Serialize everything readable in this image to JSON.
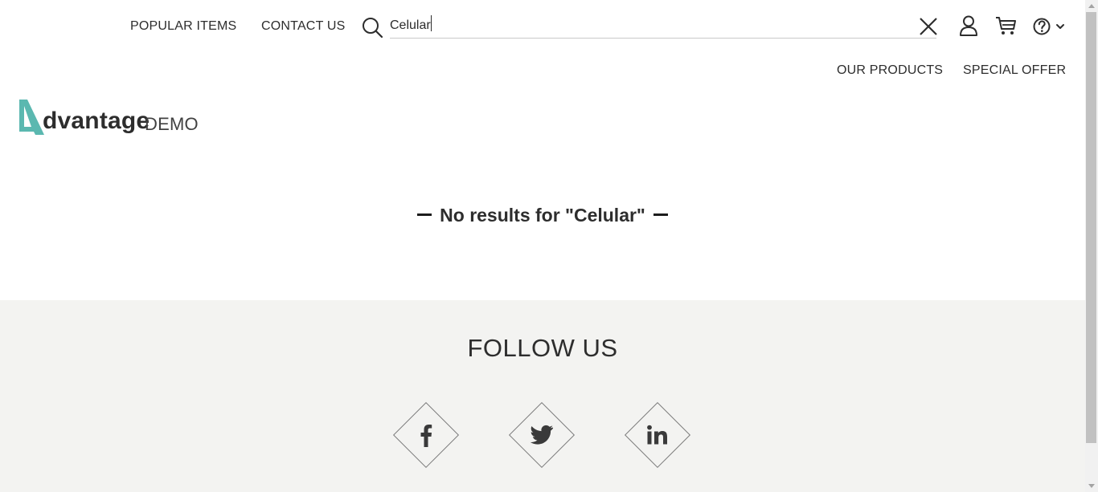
{
  "header": {
    "nav": [
      {
        "label": "POPULAR ITEMS"
      },
      {
        "label": "CONTACT US"
      }
    ],
    "search": {
      "value": "Celular",
      "icon": "search-icon"
    },
    "icons": [
      "close-icon",
      "user-icon",
      "cart-icon",
      "help-icon"
    ],
    "sub_nav": [
      {
        "label": "OUR PRODUCTS"
      },
      {
        "label": "SPECIAL OFFER"
      }
    ]
  },
  "logo": {
    "word": "dvantage",
    "suffix": "DEMO",
    "accent": "#5bb8b0"
  },
  "main": {
    "no_results": "No results for \"Celular\""
  },
  "footer": {
    "title": "FOLLOW US",
    "social": [
      {
        "name": "facebook-icon",
        "glyph": "f"
      },
      {
        "name": "twitter-icon",
        "glyph": "twitter"
      },
      {
        "name": "linkedin-icon",
        "glyph": "in"
      }
    ],
    "background": "#f3f3f1"
  }
}
